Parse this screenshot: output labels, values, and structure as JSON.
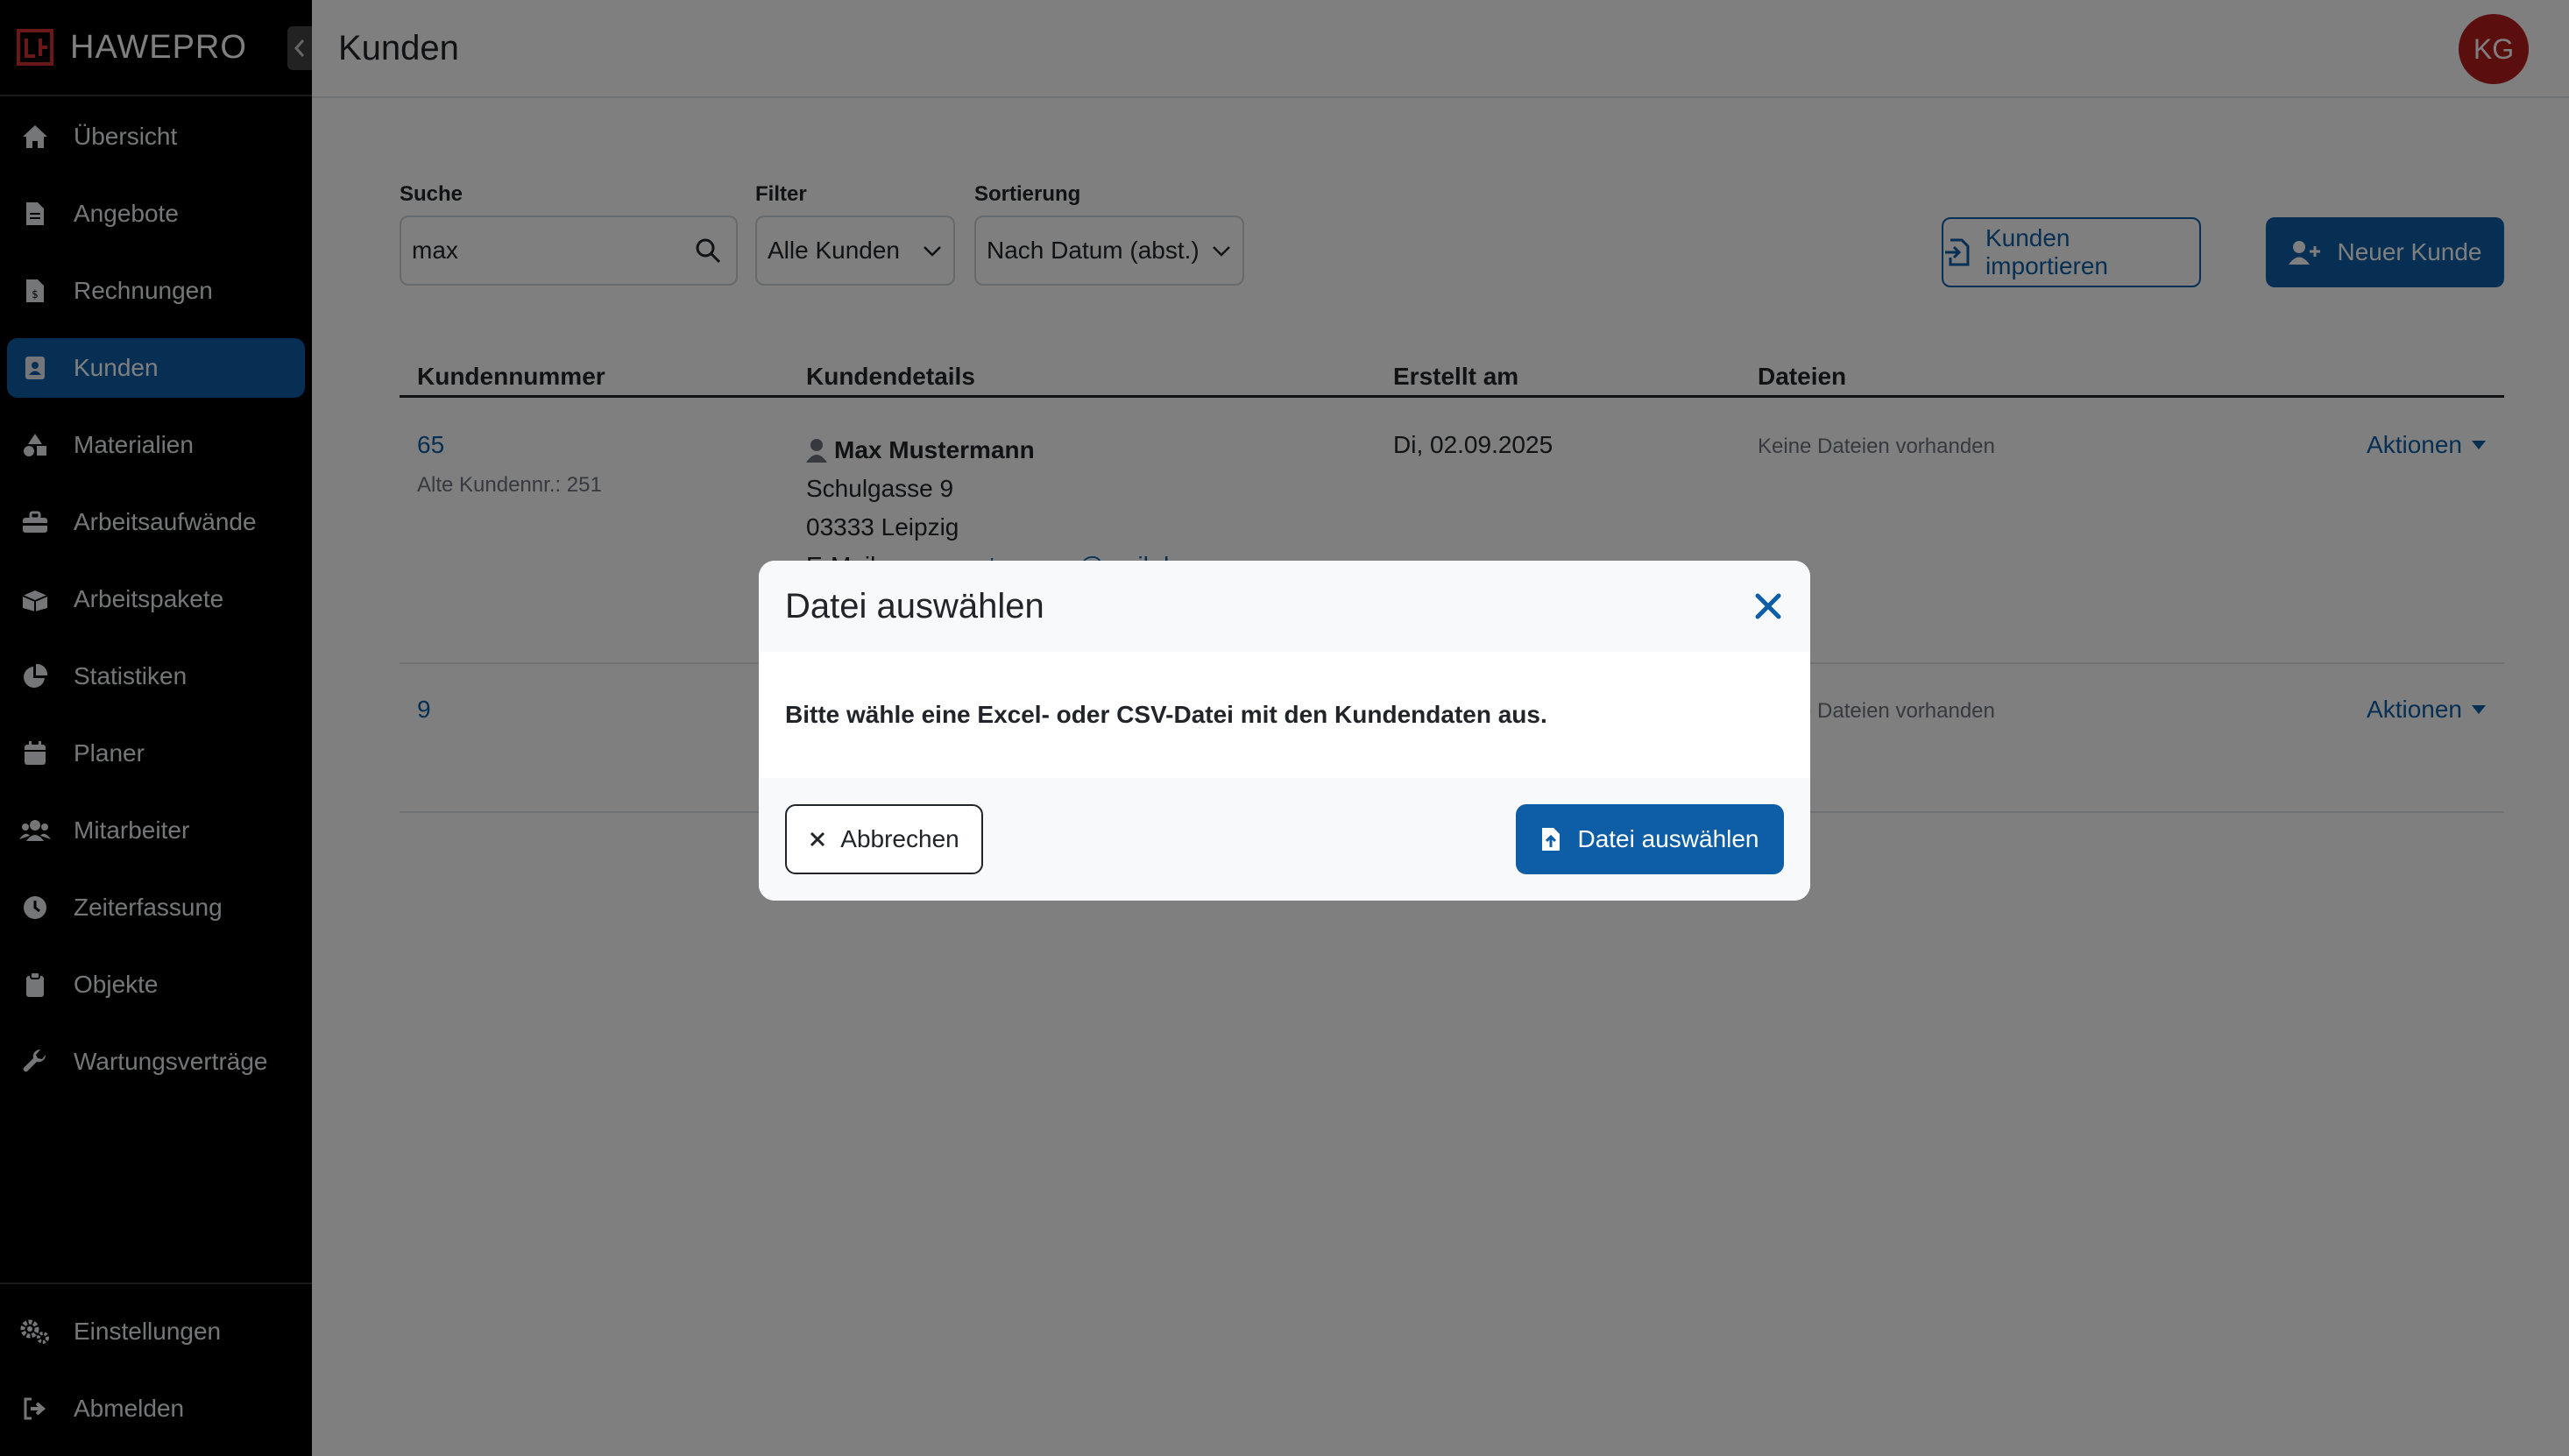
{
  "app": {
    "brand": "HAWEPRO"
  },
  "header": {
    "title": "Kunden",
    "avatar_initials": "KG"
  },
  "sidebar": {
    "items": [
      {
        "label": "Übersicht",
        "icon": "home-icon"
      },
      {
        "label": "Angebote",
        "icon": "document-icon"
      },
      {
        "label": "Rechnungen",
        "icon": "invoice-icon"
      },
      {
        "label": "Kunden",
        "icon": "contact-card-icon",
        "active": true
      },
      {
        "label": "Materialien",
        "icon": "shapes-icon"
      },
      {
        "label": "Arbeitsaufwände",
        "icon": "toolbox-icon"
      },
      {
        "label": "Arbeitspakete",
        "icon": "boxes-icon"
      },
      {
        "label": "Statistiken",
        "icon": "pie-chart-icon"
      },
      {
        "label": "Planer",
        "icon": "calendar-icon"
      },
      {
        "label": "Mitarbeiter",
        "icon": "users-icon"
      },
      {
        "label": "Zeiterfassung",
        "icon": "clock-icon"
      },
      {
        "label": "Objekte",
        "icon": "clipboard-icon"
      },
      {
        "label": "Wartungsverträge",
        "icon": "wrench-icon"
      }
    ],
    "bottom": [
      {
        "label": "Einstellungen",
        "icon": "gears-icon"
      },
      {
        "label": "Abmelden",
        "icon": "logout-icon"
      }
    ]
  },
  "controls": {
    "search_label": "Suche",
    "search_value": "max",
    "filter_label": "Filter",
    "filter_value": "Alle Kunden",
    "sort_label": "Sortierung",
    "sort_value": "Nach Datum (abst.)",
    "import_label": "Kunden importieren",
    "new_label": "Neuer Kunde"
  },
  "table": {
    "headers": [
      "Kundennummer",
      "Kundendetails",
      "Erstellt am",
      "Dateien"
    ],
    "rows": [
      {
        "number": "65",
        "old_number": "Alte Kundennr.: 251",
        "name": "Max Mustermann",
        "street": "Schulgasse 9",
        "city": "03333 Leipzig",
        "email_prefix": "E-Mail: ",
        "email": "max.mustermann@mail.de",
        "created": "Di, 02.09.2025",
        "files": "Keine Dateien vorhanden",
        "actions": "Aktionen"
      },
      {
        "number": "9",
        "files": "Keine Dateien vorhanden",
        "actions": "Aktionen"
      }
    ]
  },
  "modal": {
    "title": "Datei auswählen",
    "body": "Bitte wähle eine Excel- oder CSV-Datei mit den Kundendaten aus.",
    "cancel_label": "Abbrechen",
    "confirm_label": "Datei auswählen"
  },
  "colors": {
    "primary": "#0d5ea6",
    "sidebar_bg": "#000000",
    "avatar_bg": "#b71c1c"
  }
}
